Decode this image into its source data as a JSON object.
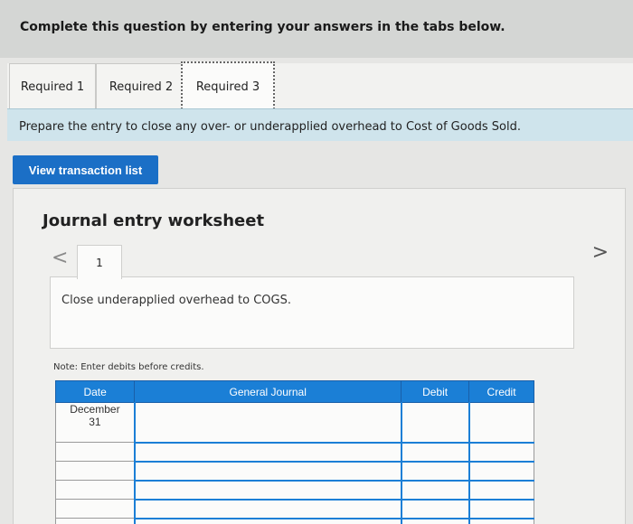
{
  "header": {
    "text": "Complete this question by entering your answers in the tabs below."
  },
  "tabs": [
    {
      "label": "Required 1"
    },
    {
      "label": "Required 2"
    },
    {
      "label": "Required 3"
    }
  ],
  "instruction": "Prepare the entry to close any over- or underapplied overhead to Cost of Goods Sold.",
  "view_button": "View transaction list",
  "worksheet": {
    "title": "Journal entry worksheet",
    "nav_prev": "<",
    "nav_next": ">",
    "entry_number": "1",
    "description": "Close underapplied overhead to COGS.",
    "note": "Note: Enter debits before credits.",
    "table": {
      "headers": {
        "date": "Date",
        "journal": "General Journal",
        "debit": "Debit",
        "credit": "Credit"
      },
      "first_row": {
        "month": "December",
        "day": "31"
      }
    }
  }
}
